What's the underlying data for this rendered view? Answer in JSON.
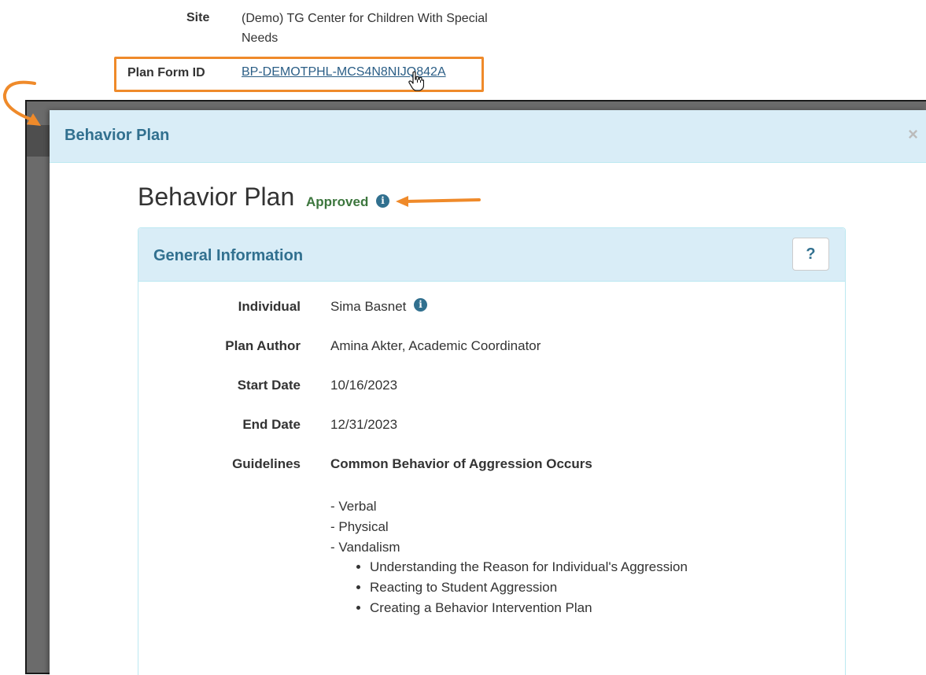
{
  "background_page": {
    "site_label": "Site",
    "site_value": "(Demo) TG Center for Children With Special Needs",
    "plan_form_id_label": "Plan Form ID",
    "plan_form_id_value": "BP-DEMOTPHL-MCS4N8NIJQ842A"
  },
  "modal": {
    "title": "Behavior Plan",
    "close_label": "×"
  },
  "plan": {
    "heading": "Behavior Plan",
    "status": "Approved"
  },
  "panel": {
    "title": "General Information",
    "help_label": "?",
    "fields": {
      "individual_label": "Individual",
      "individual_value": "Sima Basnet",
      "author_label": "Plan Author",
      "author_value": "Amina Akter, Academic Coordinator",
      "start_label": "Start Date",
      "start_value": "10/16/2023",
      "end_label": "End Date",
      "end_value": "12/31/2023",
      "guidelines_label": "Guidelines"
    },
    "guidelines": {
      "heading": "Common Behavior of Aggression Occurs",
      "lines": [
        "- Verbal",
        "- Physical",
        "- Vandalism"
      ],
      "bullets": [
        "Understanding the Reason for Individual's Aggression",
        "Reacting to Student Aggression",
        "Creating a Behavior Intervention Plan"
      ]
    }
  },
  "colors": {
    "accent_orange": "#ef8a2a",
    "header_bg": "#d9edf7",
    "header_text": "#31708f",
    "approved_green": "#3c763d",
    "link_blue": "#2b5e86"
  },
  "icons": {
    "status_info": "info-circle-icon",
    "individual_info": "info-circle-icon",
    "cursor": "hand-pointer-icon",
    "close": "close-icon"
  }
}
